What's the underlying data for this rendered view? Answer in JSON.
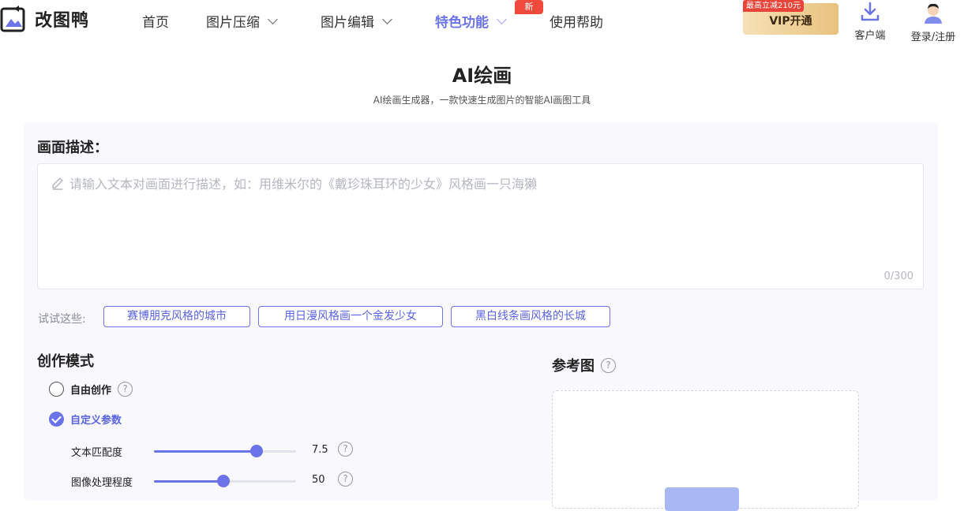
{
  "brand": {
    "name": "改图鸭"
  },
  "nav": {
    "items": [
      {
        "label": "首页",
        "dropdown": false
      },
      {
        "label": "图片压缩",
        "dropdown": true
      },
      {
        "label": "图片编辑",
        "dropdown": true
      },
      {
        "label": "特色功能",
        "dropdown": true,
        "active": true
      },
      {
        "label": "使用帮助",
        "dropdown": false
      }
    ],
    "new_badge": "新",
    "vip": {
      "tag": "最高立减210元",
      "label": "VIP开通"
    },
    "client": "客户端",
    "login": "登录/注册"
  },
  "header": {
    "title": "AI绘画",
    "subtitle": "AI绘画生成器，一款快速生成图片的智能AI画图工具"
  },
  "description": {
    "title": "画面描述：",
    "placeholder": "请输入文本对画面进行描述，如：用维米尔的《戴珍珠耳环的少女》风格画一只海獭",
    "value": "",
    "counter": "0/300"
  },
  "suggestions": {
    "label": "试试这些:",
    "items": [
      "赛博朋克风格的城市",
      "用日漫风格画一个金发少女",
      "黑白线条画风格的长城"
    ]
  },
  "mode": {
    "title": "创作模式",
    "options": [
      {
        "label": "自由创作",
        "checked": false
      },
      {
        "label": "自定义参数",
        "checked": true
      }
    ],
    "sliders": [
      {
        "label": "文本匹配度",
        "value": "7.5",
        "fraction": 0.72
      },
      {
        "label": "图像处理程度",
        "value": "50",
        "fraction": 0.49
      }
    ]
  },
  "reference": {
    "title": "参考图"
  },
  "colors": {
    "accent": "#6b73e8",
    "badge": "#ef4a3c",
    "vip_gold": "#e8c27f"
  }
}
